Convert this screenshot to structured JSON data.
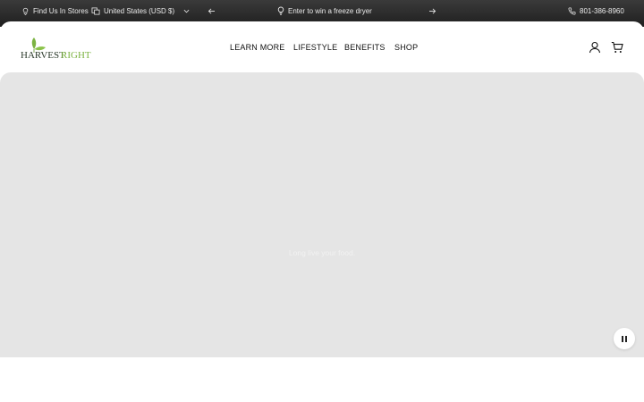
{
  "topbar": {
    "find_stores": "Find Us In Stores",
    "region": "United States (USD $)",
    "announcement": "Enter to win a freeze dryer",
    "phone": "801-386-8960",
    "icons": [
      "location-pin-icon",
      "currency-icon",
      "chevron-down-icon",
      "arrow-left-icon",
      "lightbulb-icon",
      "arrow-right-icon",
      "phone-icon"
    ]
  },
  "header": {
    "logo_text": {
      "part1": "HARVEST",
      "part2": "RIGHT"
    },
    "nav": [
      "LEARN MORE",
      "LIFESTYLE",
      "BENEFITS",
      "SHOP"
    ],
    "icons": [
      "account-icon",
      "cart-icon"
    ]
  },
  "hero": {
    "tagline": "Long live your food.",
    "video_control": "pause-icon"
  },
  "colors": {
    "topbar_bg": "#262626",
    "hero_bg": "#e5e5e5",
    "logo_green": "#7cb342",
    "logo_dark": "#2b3a2b"
  }
}
